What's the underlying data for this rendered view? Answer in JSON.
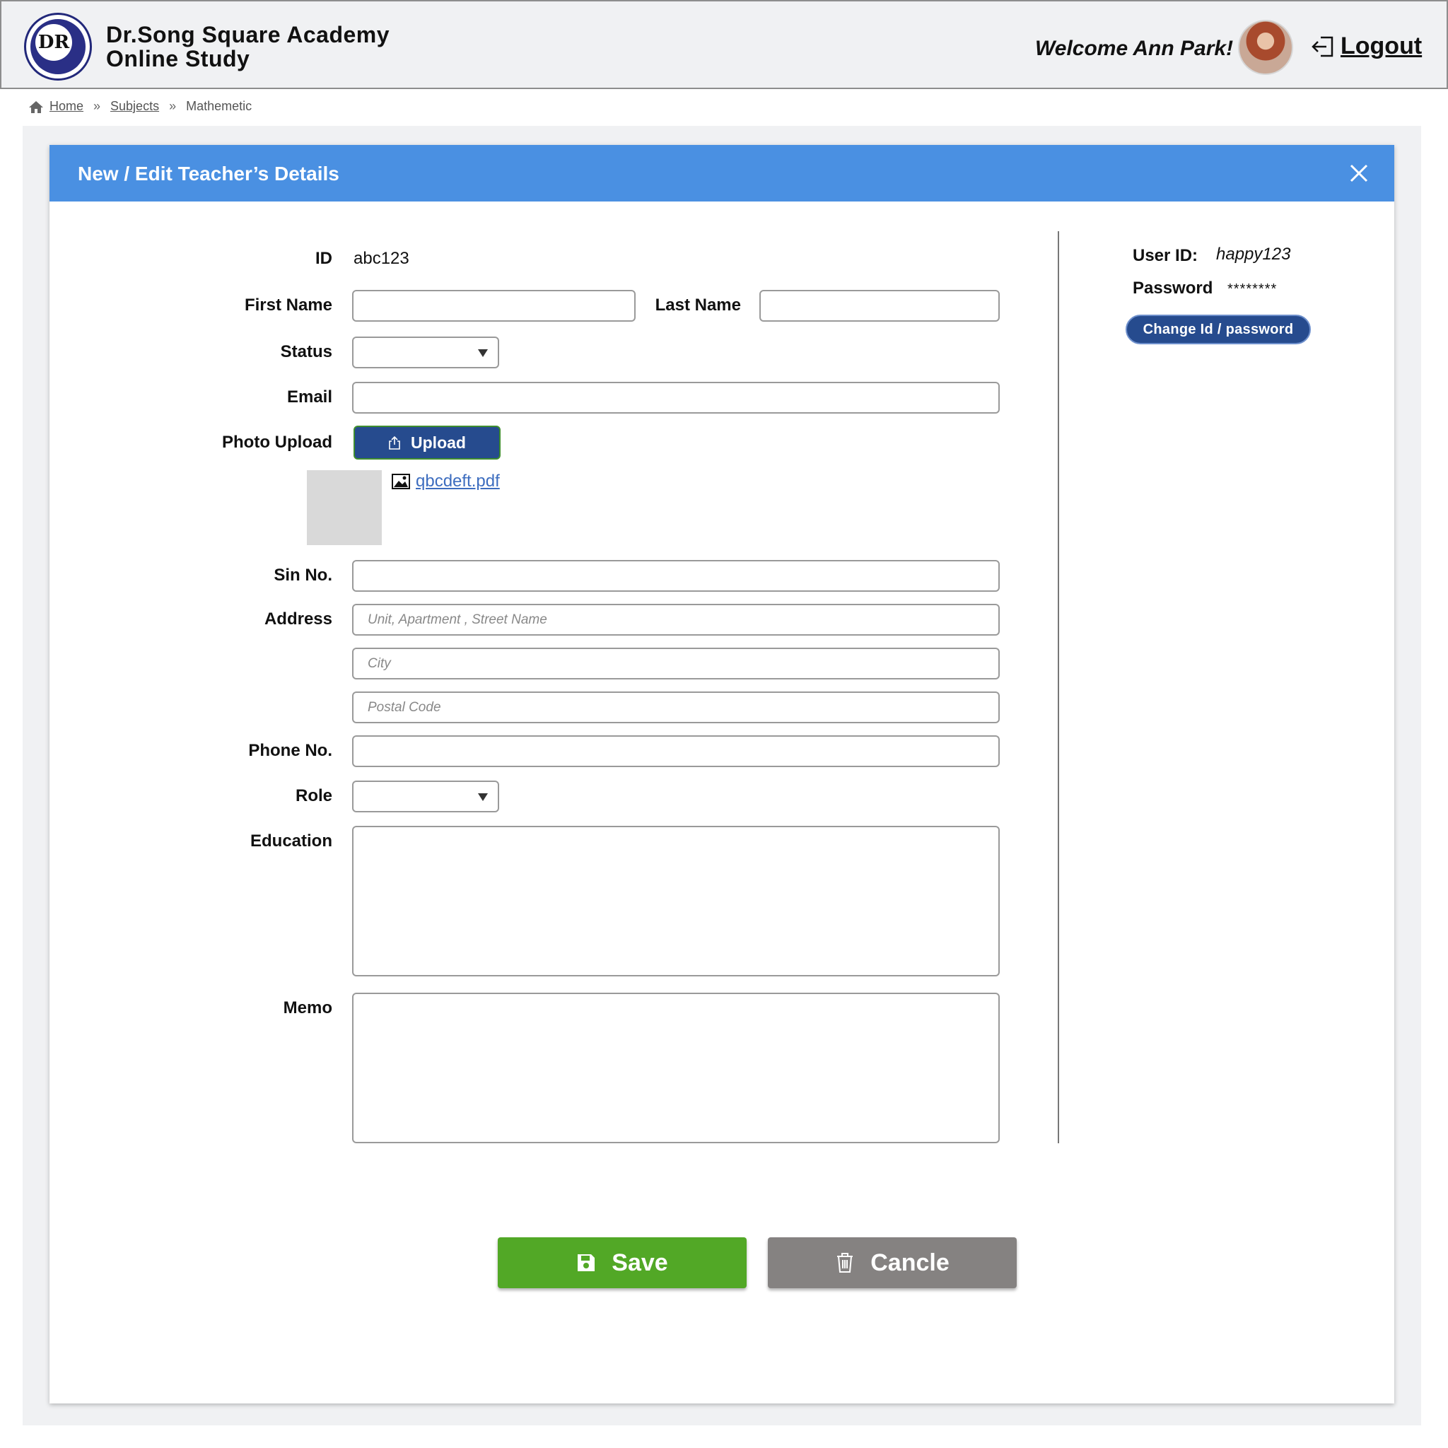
{
  "header": {
    "logo_text": "DR",
    "brand_line1": "Dr.Song Square Academy",
    "brand_line2": "Online Study",
    "welcome": "Welcome Ann Park!",
    "logout_label": "Logout"
  },
  "breadcrumb": {
    "items": [
      "Home",
      "Subjects",
      "Mathemetic"
    ]
  },
  "modal": {
    "title": "New / Edit Teacher’s Details",
    "form": {
      "id_label": "ID",
      "id_value": "abc123",
      "first_name_label": "First Name",
      "last_name_label": "Last Name",
      "status_label": "Status",
      "email_label": "Email",
      "photo_label": "Photo Upload",
      "upload_label": "Upload",
      "file_name": "qbcdeft.pdf",
      "sin_label": "Sin No.",
      "address_label": "Address",
      "address_placeholder_street": "Unit, Apartment , Street Name",
      "address_placeholder_city": "City",
      "address_placeholder_postal": "Postal Code",
      "phone_label": "Phone No.",
      "role_label": "Role",
      "education_label": "Education",
      "memo_label": "Memo"
    },
    "account": {
      "user_id_label": "User ID:",
      "user_id_value": "happy123",
      "password_label": "Password",
      "password_value": "********",
      "change_label": "Change Id / password"
    },
    "actions": {
      "save_label": "Save",
      "cancel_label": "Cancle"
    }
  },
  "colors": {
    "modal_header": "#4a90e2",
    "primary_dark": "#264b8e",
    "save_green": "#52a826",
    "cancel_gray": "#858281"
  }
}
